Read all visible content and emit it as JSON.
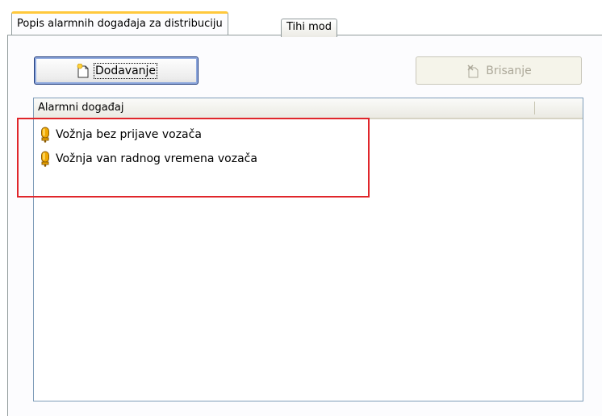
{
  "tabs": [
    {
      "label": "Popis alarmnih događaja za distribuciju",
      "active": true
    },
    {
      "label": "Tihi mod",
      "active": false
    }
  ],
  "toolbar": {
    "add_label": "Dodavanje",
    "add_icon": "new-document-icon",
    "delete_label": "Brisanje",
    "delete_icon": "delete-document-icon",
    "delete_enabled": false
  },
  "list": {
    "column_header": "Alarmni događaj",
    "items": [
      {
        "label": "Vožnja bez prijave vozača",
        "icon": "alarm-bell-icon"
      },
      {
        "label": "Vožnja van radnog vremena vozača",
        "icon": "alarm-bell-icon"
      }
    ]
  },
  "colors": {
    "active_tab_accent": "#ffc83c",
    "annotation_box": "#e0262b",
    "alarm_icon": "#f0a800"
  }
}
